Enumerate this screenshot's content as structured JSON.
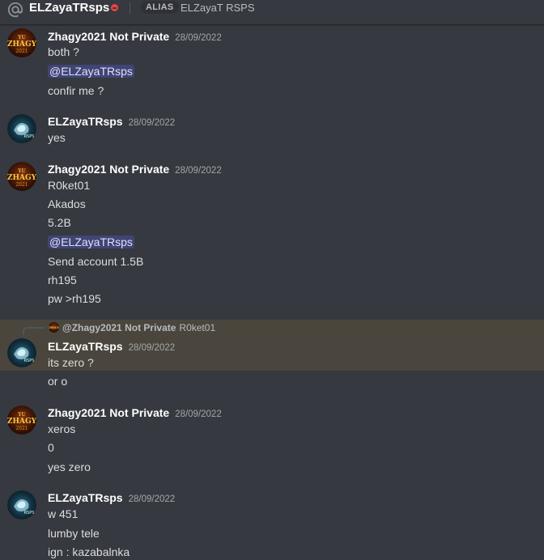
{
  "header": {
    "username": "ELZayaTRsps",
    "alias_label": "ALIAS",
    "alias_value": "ELZayaT RSPS"
  },
  "messages": [
    {
      "author": "Zhagy2021 Not Private",
      "time": "28/09/2022",
      "lines": [
        "both ?",
        "@ELZayaTRsps",
        "confir me ?"
      ]
    },
    {
      "author": "ELZayaTRsps",
      "time": "28/09/2022",
      "lines": [
        "yes"
      ]
    },
    {
      "author": "Zhagy2021 Not Private",
      "time": "28/09/2022",
      "lines": [
        "R0ket01",
        "Akados",
        "5.2B",
        "@ELZayaTRsps",
        "Send account 1.5B",
        "rh195",
        "pw >rh195"
      ]
    },
    {
      "author": "ELZayaTRsps",
      "time": "28/09/2022",
      "reply": {
        "author": "@Zhagy2021 Not Private",
        "text": "R0ket01"
      },
      "lines": [
        "its zero ?",
        "or o"
      ]
    },
    {
      "author": "Zhagy2021 Not Private",
      "time": "28/09/2022",
      "lines": [
        "xeros",
        "0",
        "yes zero"
      ]
    },
    {
      "author": "ELZayaTRsps",
      "time": "28/09/2022",
      "lines": [
        "w 451",
        "lumby tele",
        "ign : kazabalnka"
      ]
    }
  ],
  "colors": {
    "background": "#36393f",
    "reply_highlight": "#4a463d",
    "mention_bg": "rgba(88,101,242,0.3)",
    "dnd_status": "#ed4245"
  }
}
